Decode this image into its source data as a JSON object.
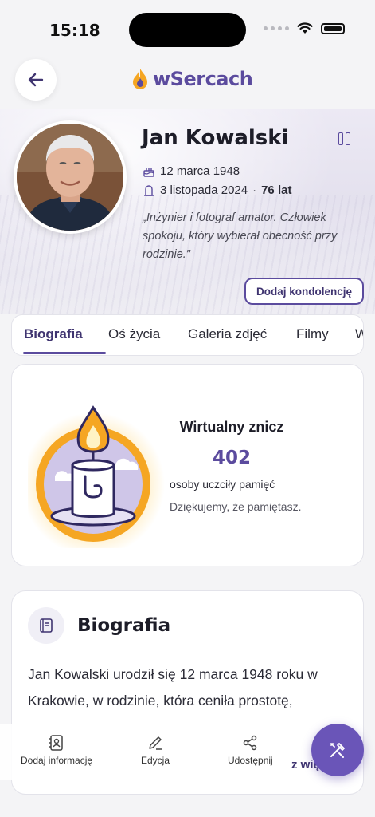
{
  "status_bar": {
    "time": "15:18"
  },
  "header": {
    "logo_text": "wSercach"
  },
  "profile": {
    "name": "Jan Kowalski",
    "birth_date": "12 marca 1948",
    "death_date": "3 listopada 2024",
    "separator": "·",
    "age": "76 lat",
    "quote": "„Inżynier i fotograf amator. Człowiek spokoju, który wybierał obecność przy rodzinie.\"",
    "condolence_label": "Dodaj kondolencję"
  },
  "tabs": [
    {
      "label": "Biografia"
    },
    {
      "label": "Oś życia"
    },
    {
      "label": "Galeria zdjęć"
    },
    {
      "label": "Filmy"
    },
    {
      "label": "W"
    }
  ],
  "candle": {
    "title": "Wirtualny znicz",
    "count": "402",
    "subtitle": "osoby uczciły pamięć",
    "thanks": "Dziękujemy, że pamiętasz."
  },
  "biography": {
    "title": "Biografia",
    "text": "Jan Kowalski urodził się 12 marca 1948 roku w Krakowie, w rodzinie, która ceniła prostotę, "
  },
  "actions": {
    "add_info": "Dodaj informację",
    "edit": "Edycja",
    "share": "Udostępnij",
    "more": "z wię"
  },
  "colors": {
    "accent": "#5b4b9e",
    "flame": "#f5a623",
    "fab": "#6a55b8"
  }
}
